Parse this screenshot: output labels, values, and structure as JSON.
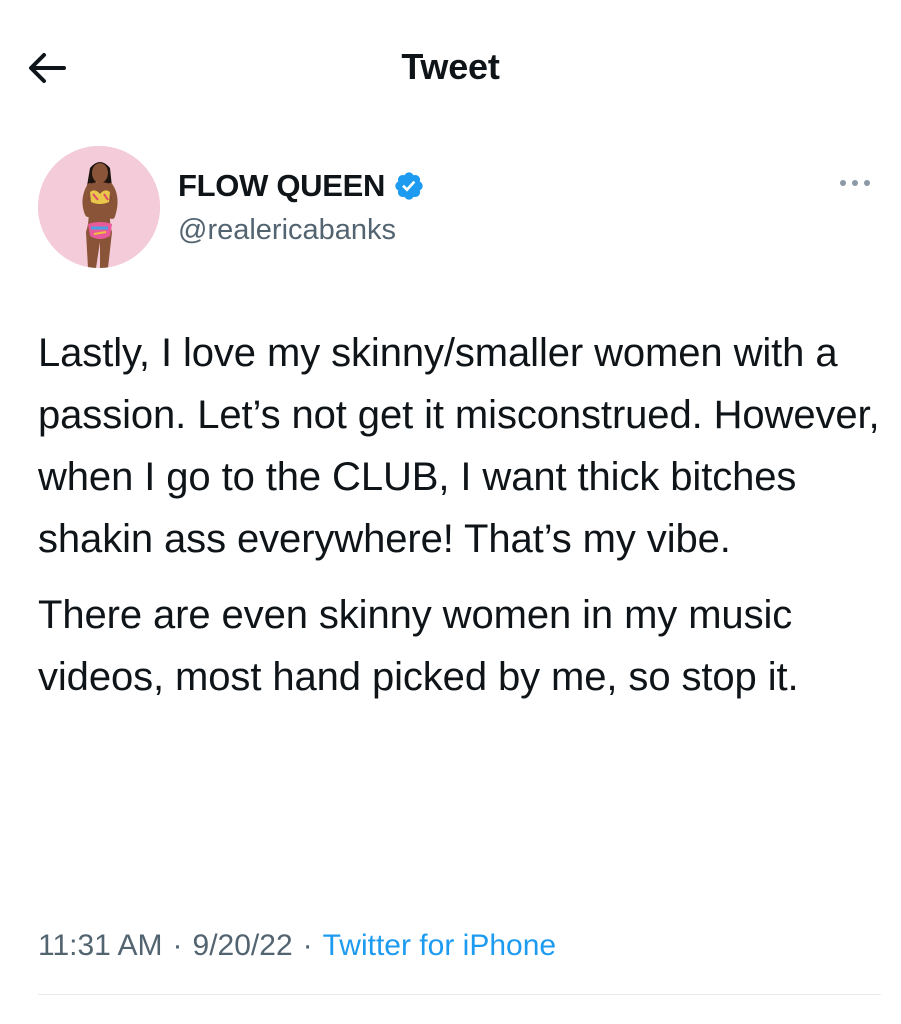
{
  "header": {
    "title": "Tweet",
    "back_icon": "arrow-left-icon"
  },
  "author": {
    "display_name": "FLOW QUEEN",
    "handle": "@realericabanks",
    "verified_icon": "verified-badge-icon",
    "more_icon": "more-options-icon"
  },
  "tweet": {
    "paragraphs": [
      "Lastly, I love my skinny/smaller women with a passion. Let’s not get it misconstrued. However, when I go to the CLUB, I want thick bitches shakin ass everywhere! That’s my vibe.",
      "There are even skinny women in my music videos, most hand picked by me, so stop it."
    ]
  },
  "meta": {
    "time": "11:31 AM",
    "separator": "·",
    "date": "9/20/22",
    "source": "Twitter for iPhone"
  },
  "colors": {
    "text_primary": "#0f1419",
    "text_secondary": "#536471",
    "accent": "#1d9bf0",
    "divider": "#e6ecf0"
  }
}
